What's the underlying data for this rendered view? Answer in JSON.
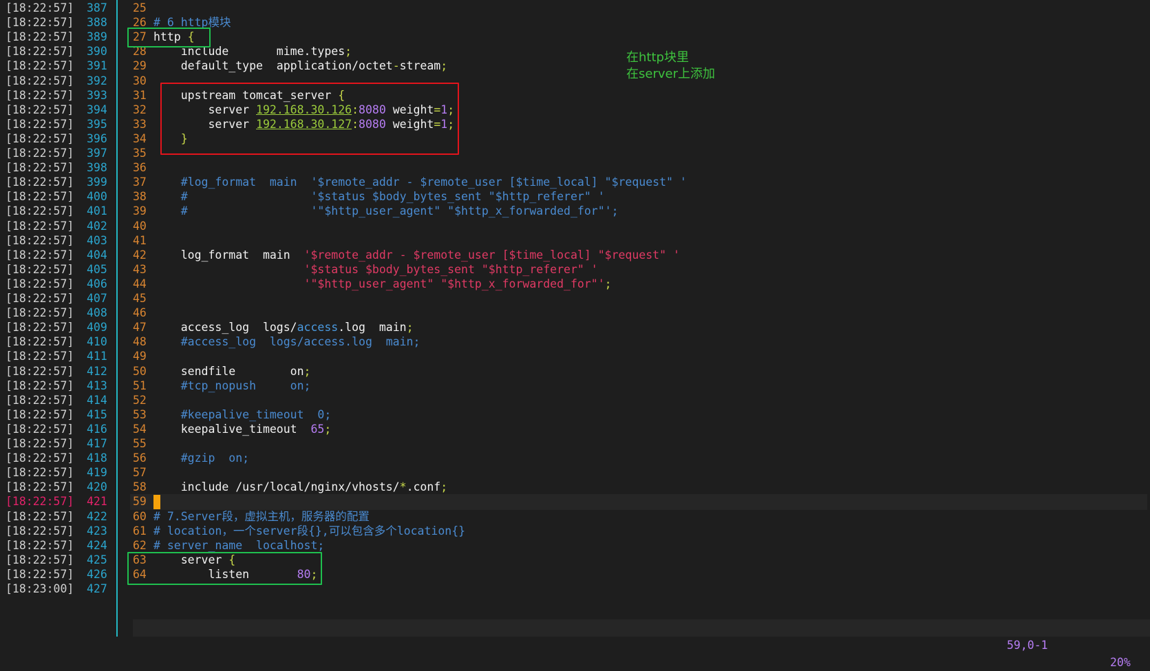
{
  "gutter": [
    {
      "ts": "[18:22:57]",
      "ln": "387"
    },
    {
      "ts": "[18:22:57]",
      "ln": "388"
    },
    {
      "ts": "[18:22:57]",
      "ln": "389"
    },
    {
      "ts": "[18:22:57]",
      "ln": "390"
    },
    {
      "ts": "[18:22:57]",
      "ln": "391"
    },
    {
      "ts": "[18:22:57]",
      "ln": "392"
    },
    {
      "ts": "[18:22:57]",
      "ln": "393"
    },
    {
      "ts": "[18:22:57]",
      "ln": "394"
    },
    {
      "ts": "[18:22:57]",
      "ln": "395"
    },
    {
      "ts": "[18:22:57]",
      "ln": "396"
    },
    {
      "ts": "[18:22:57]",
      "ln": "397"
    },
    {
      "ts": "[18:22:57]",
      "ln": "398"
    },
    {
      "ts": "[18:22:57]",
      "ln": "399"
    },
    {
      "ts": "[18:22:57]",
      "ln": "400"
    },
    {
      "ts": "[18:22:57]",
      "ln": "401"
    },
    {
      "ts": "[18:22:57]",
      "ln": "402"
    },
    {
      "ts": "[18:22:57]",
      "ln": "403"
    },
    {
      "ts": "[18:22:57]",
      "ln": "404"
    },
    {
      "ts": "[18:22:57]",
      "ln": "405"
    },
    {
      "ts": "[18:22:57]",
      "ln": "406"
    },
    {
      "ts": "[18:22:57]",
      "ln": "407"
    },
    {
      "ts": "[18:22:57]",
      "ln": "408"
    },
    {
      "ts": "[18:22:57]",
      "ln": "409"
    },
    {
      "ts": "[18:22:57]",
      "ln": "410"
    },
    {
      "ts": "[18:22:57]",
      "ln": "411"
    },
    {
      "ts": "[18:22:57]",
      "ln": "412"
    },
    {
      "ts": "[18:22:57]",
      "ln": "413"
    },
    {
      "ts": "[18:22:57]",
      "ln": "414"
    },
    {
      "ts": "[18:22:57]",
      "ln": "415"
    },
    {
      "ts": "[18:22:57]",
      "ln": "416"
    },
    {
      "ts": "[18:22:57]",
      "ln": "417"
    },
    {
      "ts": "[18:22:57]",
      "ln": "418"
    },
    {
      "ts": "[18:22:57]",
      "ln": "419"
    },
    {
      "ts": "[18:22:57]",
      "ln": "420"
    },
    {
      "ts": "[18:22:57]",
      "ln": "421",
      "active": true
    },
    {
      "ts": "[18:22:57]",
      "ln": "422"
    },
    {
      "ts": "[18:22:57]",
      "ln": "423"
    },
    {
      "ts": "[18:22:57]",
      "ln": "424"
    },
    {
      "ts": "[18:22:57]",
      "ln": "425"
    },
    {
      "ts": "[18:22:57]",
      "ln": "426"
    },
    {
      "ts": "[18:23:00]",
      "ln": "427"
    }
  ],
  "code": [
    {
      "n": "25",
      "segs": []
    },
    {
      "n": "26",
      "segs": [
        [
          "cmt",
          "# 6 http模块"
        ]
      ]
    },
    {
      "n": "27",
      "segs": [
        [
          "white",
          "http "
        ],
        [
          "punc",
          "{"
        ]
      ]
    },
    {
      "n": "28",
      "segs": [
        [
          "white",
          "    include       mime.types"
        ],
        [
          "punc",
          ";"
        ]
      ]
    },
    {
      "n": "29",
      "segs": [
        [
          "white",
          "    default_type  application/octet"
        ],
        [
          "punc",
          "-"
        ],
        [
          "white",
          "stream"
        ],
        [
          "punc",
          ";"
        ]
      ]
    },
    {
      "n": "30",
      "segs": []
    },
    {
      "n": "31",
      "segs": [
        [
          "white",
          "    upstream tomcat_server "
        ],
        [
          "punc",
          "{"
        ]
      ]
    },
    {
      "n": "32",
      "segs": [
        [
          "white",
          "        server "
        ],
        [
          "ip",
          "192.168.30.126"
        ],
        [
          "punc",
          ":"
        ],
        [
          "num",
          "8080"
        ],
        [
          "white",
          " weight"
        ],
        [
          "punc",
          "="
        ],
        [
          "num",
          "1"
        ],
        [
          "punc",
          ";"
        ]
      ]
    },
    {
      "n": "33",
      "segs": [
        [
          "white",
          "        server "
        ],
        [
          "ip",
          "192.168.30.127"
        ],
        [
          "punc",
          ":"
        ],
        [
          "num",
          "8080"
        ],
        [
          "white",
          " weight"
        ],
        [
          "punc",
          "="
        ],
        [
          "num",
          "1"
        ],
        [
          "punc",
          ";"
        ]
      ]
    },
    {
      "n": "34",
      "segs": [
        [
          "punc",
          "    }"
        ]
      ]
    },
    {
      "n": "35",
      "segs": []
    },
    {
      "n": "36",
      "segs": []
    },
    {
      "n": "37",
      "segs": [
        [
          "cmt",
          "    #log_format  main  '$remote_addr - $remote_user [$time_local] \"$request\" '"
        ]
      ]
    },
    {
      "n": "38",
      "segs": [
        [
          "cmt",
          "    #                  '$status $body_bytes_sent \"$http_referer\" '"
        ]
      ]
    },
    {
      "n": "39",
      "segs": [
        [
          "cmt",
          "    #                  '\"$http_user_agent\" \"$http_x_forwarded_for\"';"
        ]
      ]
    },
    {
      "n": "40",
      "segs": []
    },
    {
      "n": "41",
      "segs": []
    },
    {
      "n": "42",
      "segs": [
        [
          "white",
          "    log_format  main  "
        ],
        [
          "str",
          "'$remote_addr - $remote_user [$time_local] \"$request\" '"
        ]
      ]
    },
    {
      "n": "43",
      "segs": [
        [
          "str",
          "                      '$status $body_bytes_sent \"$http_referer\" '"
        ]
      ]
    },
    {
      "n": "44",
      "segs": [
        [
          "str",
          "                      '\"$http_user_agent\" \"$http_x_forwarded_for\"'"
        ],
        [
          "punc",
          ";"
        ]
      ]
    },
    {
      "n": "45",
      "segs": []
    },
    {
      "n": "46",
      "segs": []
    },
    {
      "n": "47",
      "segs": [
        [
          "white",
          "    access_log  logs/"
        ],
        [
          "blue",
          "access"
        ],
        [
          "white",
          ".log  main"
        ],
        [
          "punc",
          ";"
        ]
      ]
    },
    {
      "n": "48",
      "segs": [
        [
          "cmt",
          "    #access_log  logs/access.log  main;"
        ]
      ]
    },
    {
      "n": "49",
      "segs": []
    },
    {
      "n": "50",
      "segs": [
        [
          "white",
          "    sendfile        on"
        ],
        [
          "punc",
          ";"
        ]
      ]
    },
    {
      "n": "51",
      "segs": [
        [
          "cmt",
          "    #tcp_nopush     on;"
        ]
      ]
    },
    {
      "n": "52",
      "segs": []
    },
    {
      "n": "53",
      "segs": [
        [
          "cmt",
          "    #keepalive_timeout  0;"
        ]
      ]
    },
    {
      "n": "54",
      "segs": [
        [
          "white",
          "    keepalive_timeout  "
        ],
        [
          "num",
          "65"
        ],
        [
          "punc",
          ";"
        ]
      ]
    },
    {
      "n": "55",
      "segs": []
    },
    {
      "n": "56",
      "segs": [
        [
          "cmt",
          "    #gzip  on;"
        ]
      ]
    },
    {
      "n": "57",
      "segs": []
    },
    {
      "n": "58",
      "segs": [
        [
          "white",
          "    include /usr/local/nginx/vhosts/"
        ],
        [
          "punc",
          "*"
        ],
        [
          "white",
          ".conf"
        ],
        [
          "punc",
          ";"
        ]
      ]
    },
    {
      "n": "59",
      "segs": [],
      "cursor": true
    },
    {
      "n": "60",
      "segs": [
        [
          "cmt",
          "# 7.Server段，虚拟主机，服务器的配置"
        ]
      ]
    },
    {
      "n": "61",
      "segs": [
        [
          "cmt",
          "# location，一个server段{},可以包含多个location{}"
        ]
      ]
    },
    {
      "n": "62",
      "segs": [
        [
          "cmt",
          "# server_name  localhost;"
        ]
      ]
    },
    {
      "n": "63",
      "segs": [
        [
          "white",
          "    server "
        ],
        [
          "punc",
          "{"
        ]
      ]
    },
    {
      "n": "64",
      "segs": [
        [
          "white",
          "        listen       "
        ],
        [
          "num",
          "80"
        ],
        [
          "punc",
          ";"
        ]
      ]
    }
  ],
  "annotation": {
    "line1": "在http块里",
    "line2": "在server上添加"
  },
  "status": {
    "position": "59,0-1",
    "percent": "20%"
  },
  "colors": {
    "background": "#1e1e1e",
    "gutter_timestamp": "#d0d0d0",
    "gutter_line_number": "#2ba6ce",
    "active_line": "#e3226a",
    "code_line_number": "#d98531",
    "comment": "#4a8bd1",
    "string": "#e03a64",
    "number": "#b67df3",
    "ip": "#9ccc3c",
    "punctuation": "#c8d94a",
    "cursor": "#f5a20b",
    "annotation_green": "#3ec23e",
    "box_green": "#1fbf4e",
    "box_red": "#e2141c"
  }
}
